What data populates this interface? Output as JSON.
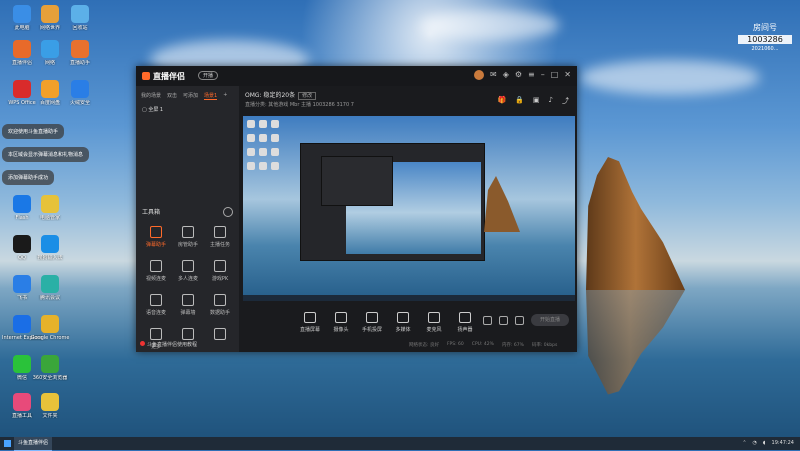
{
  "desktop": {
    "icons": [
      {
        "label": "此电脑",
        "color": "#3a8ee6"
      },
      {
        "label": "网络世界",
        "color": "#e6a03a"
      },
      {
        "label": "回收站",
        "color": "#5cb0e8"
      },
      {
        "label": "直播伴侣",
        "color": "#e86a2a"
      },
      {
        "label": "网络",
        "color": "#3a9ee6"
      },
      {
        "label": "直播助手",
        "color": "#e8712e"
      },
      {
        "label": "WPS Office",
        "color": "#d92b2b"
      },
      {
        "label": "百度网盘",
        "color": "#f2a02a"
      },
      {
        "label": "火绒安全",
        "color": "#2a7ee6"
      },
      {
        "label": "Flash",
        "color": "#1a78e6"
      },
      {
        "label": "电脑管家",
        "color": "#e6c23a"
      },
      {
        "label": "QQ",
        "color": "#1a1a1a"
      },
      {
        "label": "搜狗输入法",
        "color": "#1a8ee6"
      },
      {
        "label": "飞书",
        "color": "#2a7ee6"
      },
      {
        "label": "腾讯会议",
        "color": "#2ab0a6"
      },
      {
        "label": "Internet Explorer",
        "color": "#1a6ee6"
      },
      {
        "label": "Google Chrome",
        "color": "#e6b22a"
      },
      {
        "label": "微信",
        "color": "#2ac23a"
      },
      {
        "label": "360安全浏览器",
        "color": "#3aa63a"
      },
      {
        "label": "直播工具",
        "color": "#e84a7a"
      },
      {
        "label": "文件夹",
        "color": "#e8c23a"
      }
    ],
    "notifications": [
      "欢迎使用斗鱼直播助手",
      "本区域会显示弹幕消息和礼物消息",
      "添加弹幕助手成功"
    ],
    "room": {
      "title": "房间号",
      "number": "1003286",
      "sub": "2021060..."
    }
  },
  "window": {
    "logo": "直播伴侣",
    "pill": "开播",
    "sidebar": {
      "tabs": [
        "我的场景",
        "双击",
        "可添加",
        "场景1"
      ],
      "active_tab": 3,
      "scene_item": "全屏 1",
      "tools_title": "工具箱",
      "tools": [
        {
          "label": "弹幕助手",
          "on": true
        },
        {
          "label": "房管助手",
          "on": false
        },
        {
          "label": "主播任务",
          "on": false
        },
        {
          "label": "视频连麦",
          "on": false
        },
        {
          "label": "多人连麦",
          "on": false
        },
        {
          "label": "游戏PK",
          "on": false
        },
        {
          "label": "语音连麦",
          "on": false
        },
        {
          "label": "弹幕墙",
          "on": false
        },
        {
          "label": "数据助手",
          "on": false
        },
        {
          "label": "更多",
          "on": false
        },
        {
          "label": "",
          "on": false
        },
        {
          "label": "",
          "on": false
        }
      ],
      "footer": "斗鱼直播伴侣使用教程"
    },
    "main": {
      "header": "OMG: 稳定的20条",
      "header_badge": "修改",
      "info": "直播分类: 其他游戏  Mbr  主播  1003286  3170  7",
      "controls": [
        "直播屏幕",
        "摄像头",
        "手机投屏",
        "多媒体",
        "麦克风",
        "扬声器"
      ],
      "golive": "开始直播",
      "status": [
        "网络状态: 良好",
        "FPS: 60",
        "CPU: 42%",
        "内存: 67%",
        "码率: 0kbps"
      ]
    }
  },
  "taskbar": {
    "app": "斗鱼直播伴侣",
    "time": "19:47:24"
  }
}
